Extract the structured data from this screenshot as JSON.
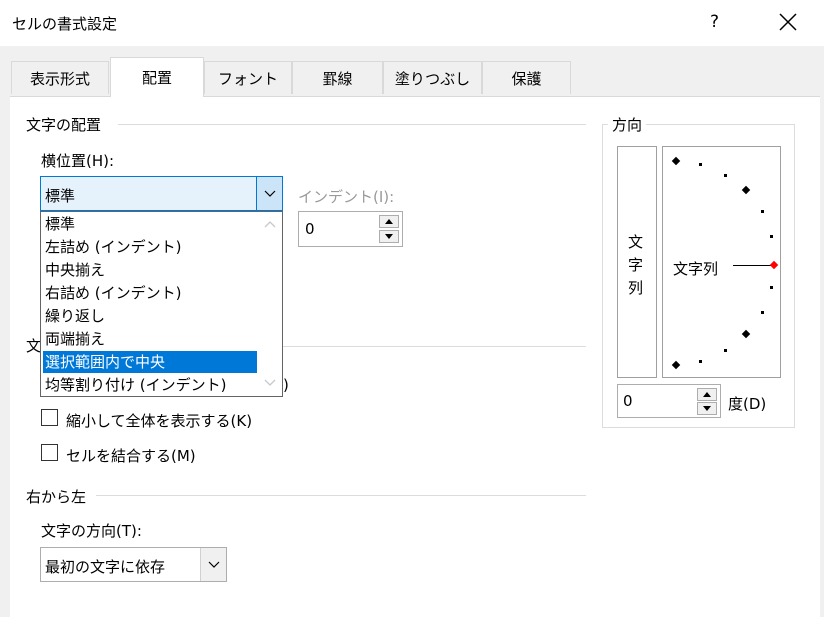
{
  "window": {
    "title": "セルの書式設定",
    "help": "?",
    "close_icon": "close-icon"
  },
  "tabs": [
    {
      "label": "表示形式"
    },
    {
      "label": "配置",
      "active": true
    },
    {
      "label": "フォント"
    },
    {
      "label": "罫線"
    },
    {
      "label": "塗りつぶし"
    },
    {
      "label": "保護"
    }
  ],
  "alignment": {
    "group_label": "文字の配置",
    "horizontal_label": "横位置(H):",
    "horizontal_value": "標準",
    "indent_label": "インデント(I):",
    "indent_value": "0",
    "dropdown_options": [
      "標準",
      "左詰め (インデント)",
      "中央揃え",
      "右詰め (インデント)",
      "繰り返し",
      "両端揃え",
      "選択範囲内で中央",
      "均等割り付け (インデント)"
    ],
    "selected_option": "選択範囲内で中央"
  },
  "text_control": {
    "group_label_fragment": "文",
    "hidden_fragment": ")",
    "shrink_label": "縮小して全体を表示する(K)",
    "merge_label": "セルを結合する(M)"
  },
  "rtl": {
    "group_label": "右から左",
    "direction_label": "文字の方向(T):",
    "direction_value": "最初の文字に依存"
  },
  "orientation": {
    "group_label": "方向",
    "vertical_text": [
      "文",
      "字",
      "列"
    ],
    "horizontal_text": "文字列",
    "degrees_value": "0",
    "degrees_label": "度(D)"
  },
  "colors": {
    "accent": "#0078d7",
    "marker": "#ff0000"
  }
}
